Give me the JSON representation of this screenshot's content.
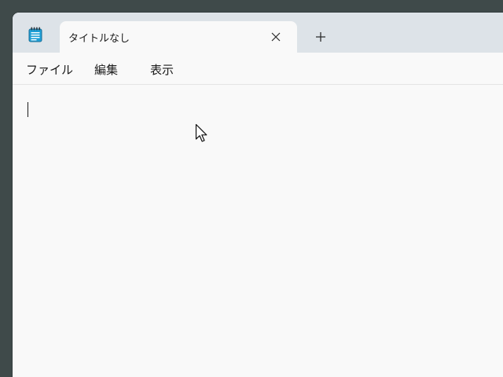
{
  "app": {
    "icon": "notepad-icon",
    "accent_color": "#1e9fd6"
  },
  "tabs": [
    {
      "label": "タイトルなし",
      "close_icon": "close-icon"
    }
  ],
  "new_tab_icon": "plus-icon",
  "menu": {
    "file": "ファイル",
    "edit": "編集",
    "view": "表示"
  },
  "editor": {
    "text": ""
  },
  "cursor_icon": "mouse-pointer-icon"
}
